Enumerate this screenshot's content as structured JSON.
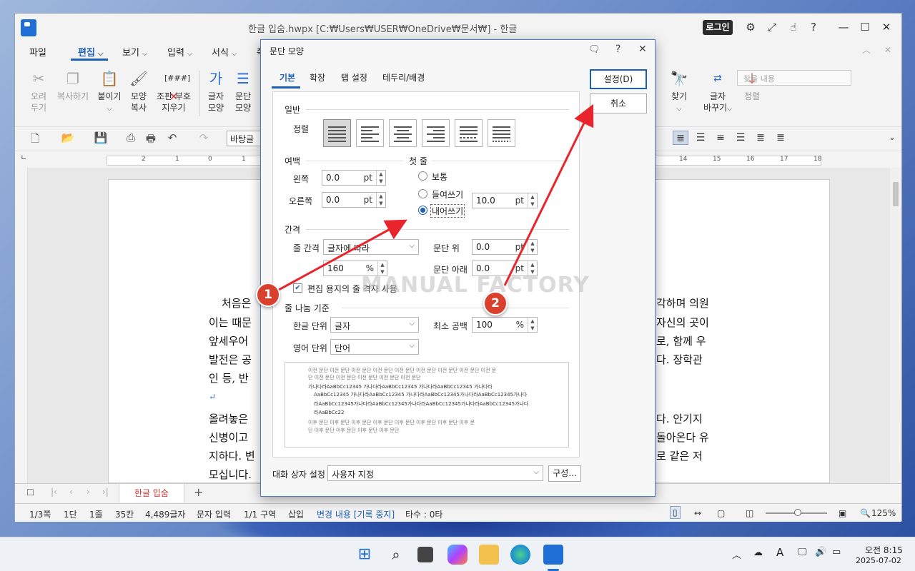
{
  "window": {
    "title": "한글 입숨.hwpx [C:₩Users₩USER₩OneDrive₩문서₩] - 한글",
    "login_label": "로그인"
  },
  "menu": {
    "items": [
      "파일",
      "편집",
      "보기",
      "입력",
      "서식",
      "쪽"
    ],
    "search_placeholder": "찾을 내용"
  },
  "ribbon": {
    "cut": [
      "오려",
      "두기"
    ],
    "copy": "복사하기",
    "paste": "붙이기",
    "format_copy": [
      "모양",
      "복사"
    ],
    "erase_codes": [
      "조판 부호",
      "지우기"
    ],
    "char_shape": [
      "글자",
      "모양"
    ],
    "para_shape": [
      "문단",
      "모양"
    ],
    "find": "찾기",
    "replace": [
      "글자",
      "바꾸기"
    ],
    "sort": "정렬",
    "code_label": "[###]"
  },
  "toolbar": {
    "style_value": "바탕글"
  },
  "ruler": {
    "numbers": [
      "2",
      "1",
      "0",
      "1",
      "2",
      "14",
      "15",
      "16",
      "17",
      "18"
    ]
  },
  "document": {
    "left_lines": [
      "처음은",
      "이는 때문",
      "앞세우어",
      "발전은 공",
      "인 등, 반",
      "↵",
      "올려놓은",
      "신병이고",
      "지하다. 변",
      "모십니다."
    ],
    "right_lines": [
      "각하며 의원",
      "자신의 곳이",
      "로, 함께 우",
      "다. 장학관",
      "다. 안기지",
      "돌아온다 유",
      "로 같은 저"
    ]
  },
  "tabbar": {
    "doc_tab": "한글 입숨"
  },
  "status": {
    "page": "1/3쪽",
    "column": "1단",
    "line": "1줄",
    "col_pos": "35칸",
    "chars": "4,489글자",
    "mode": "문자 입력",
    "section": "1/1 구역",
    "insert": "삽입",
    "changes": "변경 내용 [기록 중지]",
    "keystrokes": "타수 : 0타",
    "zoom": "125%"
  },
  "taskbar": {
    "time": "오전 8:15",
    "date": "2025-07-02"
  },
  "dialog": {
    "title": "문단 모양",
    "tabs": [
      "기본",
      "확장",
      "탭 설정",
      "테두리/배경"
    ],
    "ok_label": "설정(D)",
    "cancel_label": "취소",
    "general": {
      "title": "일반",
      "align_label": "정렬",
      "selected_align": "justify"
    },
    "margin": {
      "title": "여백",
      "left_label": "왼쪽",
      "left_value": "0.0",
      "right_label": "오른쪽",
      "right_value": "0.0",
      "unit": "pt"
    },
    "first_line": {
      "title": "첫 줄",
      "options": [
        "보통",
        "들여쓰기",
        "내어쓰기"
      ],
      "selected": "내어쓰기",
      "value": "10.0",
      "unit": "pt"
    },
    "spacing": {
      "title": "간격",
      "line_spacing_label": "줄 간격",
      "line_spacing_type": "글자에 따라",
      "line_spacing_value": "160",
      "line_spacing_unit": "%",
      "before_label": "문단 위",
      "before_value": "0.0",
      "after_label": "문단 아래",
      "after_value": "0.0",
      "unit": "pt",
      "grid_checkbox_label": "편집 용지의 줄 격자 사용",
      "grid_checked": true
    },
    "line_break": {
      "title": "줄 나눔 기준",
      "korean_label": "한글 단위",
      "korean_value": "글자",
      "english_label": "영어 단위",
      "english_value": "단어",
      "min_space_label": "최소 공백",
      "min_space_value": "100",
      "min_space_unit": "%"
    },
    "preview": {
      "prev_lines": [
        "이전 문단 이전 문단 이전 문단 이전 문단 이전 문단 이전 문단 이전 문단 이전 문단 이전 문",
        "단 이전 문단 이전 문단 이전 문단 이전 문단 이전 문단"
      ],
      "body_lines": [
        "가나다라AaBbCc12345        가나다라AaBbCc12345        가나다라AaBbCc12345        가나다라",
        "AaBbCc12345   가나다라AaBbCc12345   가나다라AaBbCc12345가나다라AaBbCc12345가나다",
        "라AaBbCc12345가나다라AaBbCc12345가나다라AaBbCc12345가나다라AaBbCc12345가나다",
        "라AaBbCc22"
      ],
      "next_lines": [
        "이후 문단 이후 문단 이후 문단 이후 문단 이후 문단 이후 문단 이후 문단 이후 문",
        "단 이후 문단 이후 문단 이후 문단 이후 문단"
      ]
    },
    "footer": {
      "preset_label": "대화 상자 설정",
      "preset_value": "사용자 지정",
      "compose_label": "구성..."
    }
  },
  "annotations": {
    "watermark": "MANUAL FACTORY",
    "badge1": "1",
    "badge2": "2",
    "arrow_color": "#e8242c",
    "badge_color": "#d9412e"
  }
}
